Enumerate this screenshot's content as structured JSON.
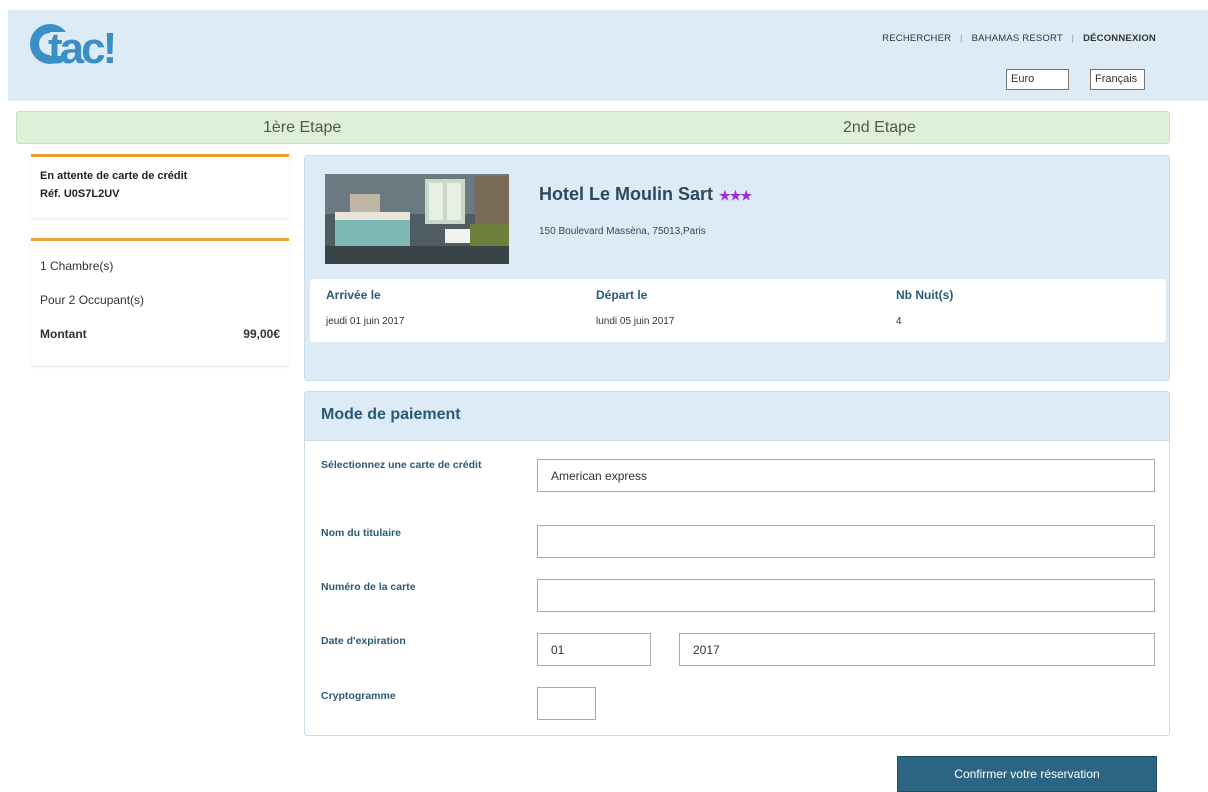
{
  "brand": {
    "logo_text": "tac!"
  },
  "nav": {
    "items": [
      "RECHERCHER",
      "BAHAMAS RESORT",
      "DÉCONNEXION"
    ]
  },
  "selectors": {
    "currency": "Euro",
    "language": "Français"
  },
  "steps": {
    "step1": "1ère Etape",
    "step2": "2nd Etape"
  },
  "status": {
    "message": "En attente de carte de crédit",
    "reference": "Réf. U0S7L2UV"
  },
  "summary": {
    "rooms": "1 Chambre(s)",
    "occupants": "Pour 2 Occupant(s)",
    "amount_label": "Montant",
    "amount_value": "99,00€"
  },
  "hotel": {
    "name": "Hotel Le Moulin Sart",
    "stars": "★★★",
    "address": "150 Boulevard Massèna, 75013,Paris",
    "arrival_label": "Arrivée le",
    "arrival_value": "jeudi 01 juin 2017",
    "departure_label": "Départ le",
    "departure_value": "lundi 05 juin 2017",
    "nights_label": "Nb Nuit(s)",
    "nights_value": "4"
  },
  "payment": {
    "title": "Mode de paiement",
    "card_type_label": "Sélectionnez une carte de crédit",
    "card_type_value": "American express",
    "holder_label": "Nom du titulaire",
    "holder_value": "",
    "number_label": "Numéro de la carte",
    "number_value": "",
    "expiry_label": "Date d'expiration",
    "expiry_month": "01",
    "expiry_year": "2017",
    "cvv_label": "Cryptogramme",
    "cvv_value": ""
  },
  "actions": {
    "confirm": "Confirmer votre réservation"
  },
  "colors": {
    "header_bg": "#dcebf5",
    "steps_bg": "#dff0d8",
    "accent_orange": "#f0a030",
    "button_bg": "#2c6582",
    "star_color": "#9b30d9",
    "logo_blue": "#3a8fc8"
  }
}
